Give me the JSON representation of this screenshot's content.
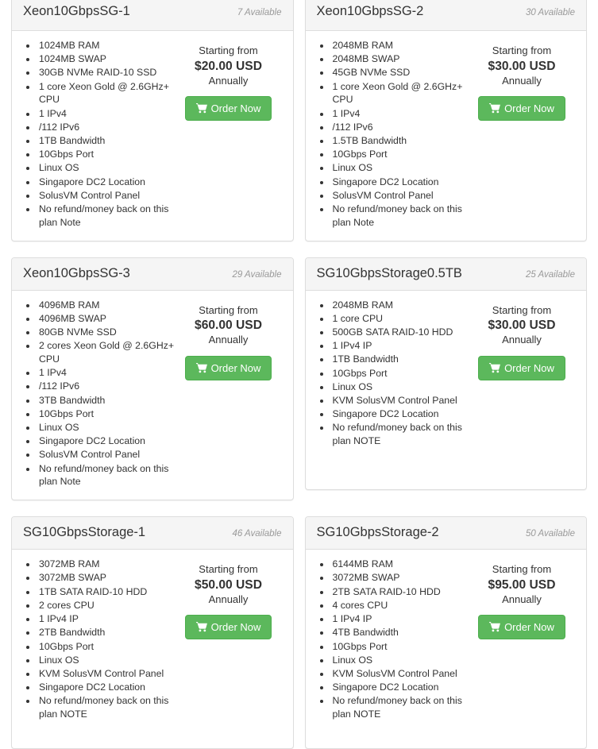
{
  "page": {
    "accent_color": "#5cb85c",
    "panel_border_color": "#dddddd",
    "panel_heading_bg": "#f5f5f5",
    "badge_color": "#999999",
    "text_color": "#333333"
  },
  "labels": {
    "price_prefix": "Starting from",
    "billing_cycle": "Annually",
    "order_button": "Order Now",
    "cart_icon": "shopping-cart-icon"
  },
  "products": [
    {
      "name": "Xeon10GbpsSG-1",
      "stock": "7 Available",
      "price": "$20.00 USD",
      "price_prefix": "Starting from",
      "billing_cycle": "Annually",
      "order_label": "Order Now",
      "features": [
        "1024MB RAM",
        "1024MB SWAP",
        "30GB NVMe RAID-10 SSD",
        "1 core Xeon Gold @ 2.6GHz+ CPU",
        "1 IPv4",
        "/112 IPv6",
        "1TB Bandwidth",
        "10Gbps Port",
        "Linux OS",
        "Singapore DC2 Location",
        "SolusVM Control Panel",
        "No refund/money back on this plan Note"
      ]
    },
    {
      "name": "Xeon10GbpsSG-2",
      "stock": "30 Available",
      "price": "$30.00 USD",
      "price_prefix": "Starting from",
      "billing_cycle": "Annually",
      "order_label": "Order Now",
      "features": [
        "2048MB RAM",
        "2048MB SWAP",
        "45GB NVMe SSD",
        "1 core Xeon Gold @ 2.6GHz+ CPU",
        "1 IPv4",
        "/112 IPv6",
        "1.5TB Bandwidth",
        "10Gbps Port",
        "Linux OS",
        "Singapore DC2 Location",
        "SolusVM Control Panel",
        "No refund/money back on this plan Note"
      ]
    },
    {
      "name": "Xeon10GbpsSG-3",
      "stock": "29 Available",
      "price": "$60.00 USD",
      "price_prefix": "Starting from",
      "billing_cycle": "Annually",
      "order_label": "Order Now",
      "features": [
        "4096MB RAM",
        "4096MB SWAP",
        "80GB NVMe SSD",
        "2 cores Xeon Gold @ 2.6GHz+ CPU",
        "1 IPv4",
        "/112 IPv6",
        "3TB Bandwidth",
        "10Gbps Port",
        "Linux OS",
        "Singapore DC2 Location",
        "SolusVM Control Panel",
        "No refund/money back on this plan Note"
      ]
    },
    {
      "name": "SG10GbpsStorage0.5TB",
      "stock": "25 Available",
      "price": "$30.00 USD",
      "price_prefix": "Starting from",
      "billing_cycle": "Annually",
      "order_label": "Order Now",
      "features": [
        "2048MB RAM",
        "1 core CPU",
        "500GB SATA RAID-10 HDD",
        "1 IPv4 IP",
        "1TB Bandwidth",
        "10Gbps Port",
        "Linux OS",
        "KVM SolusVM Control Panel",
        "Singapore DC2 Location",
        "No refund/money back on this plan NOTE"
      ]
    },
    {
      "name": "SG10GbpsStorage-1",
      "stock": "46 Available",
      "price": "$50.00 USD",
      "price_prefix": "Starting from",
      "billing_cycle": "Annually",
      "order_label": "Order Now",
      "features": [
        "3072MB RAM",
        "3072MB SWAP",
        "1TB SATA RAID-10 HDD",
        "2 cores CPU",
        "1 IPv4 IP",
        "2TB Bandwidth",
        "10Gbps Port",
        "Linux OS",
        "KVM SolusVM Control Panel",
        "Singapore DC2 Location",
        "No refund/money back on this plan NOTE"
      ]
    },
    {
      "name": "SG10GbpsStorage-2",
      "stock": "50 Available",
      "price": "$95.00 USD",
      "price_prefix": "Starting from",
      "billing_cycle": "Annually",
      "order_label": "Order Now",
      "features": [
        "6144MB RAM",
        "3072MB SWAP",
        "2TB SATA RAID-10 HDD",
        "4 cores CPU",
        "1 IPv4 IP",
        "4TB Bandwidth",
        "10Gbps Port",
        "Linux OS",
        "KVM SolusVM Control Panel",
        "Singapore DC2 Location",
        "No refund/money back on this plan NOTE"
      ]
    }
  ]
}
